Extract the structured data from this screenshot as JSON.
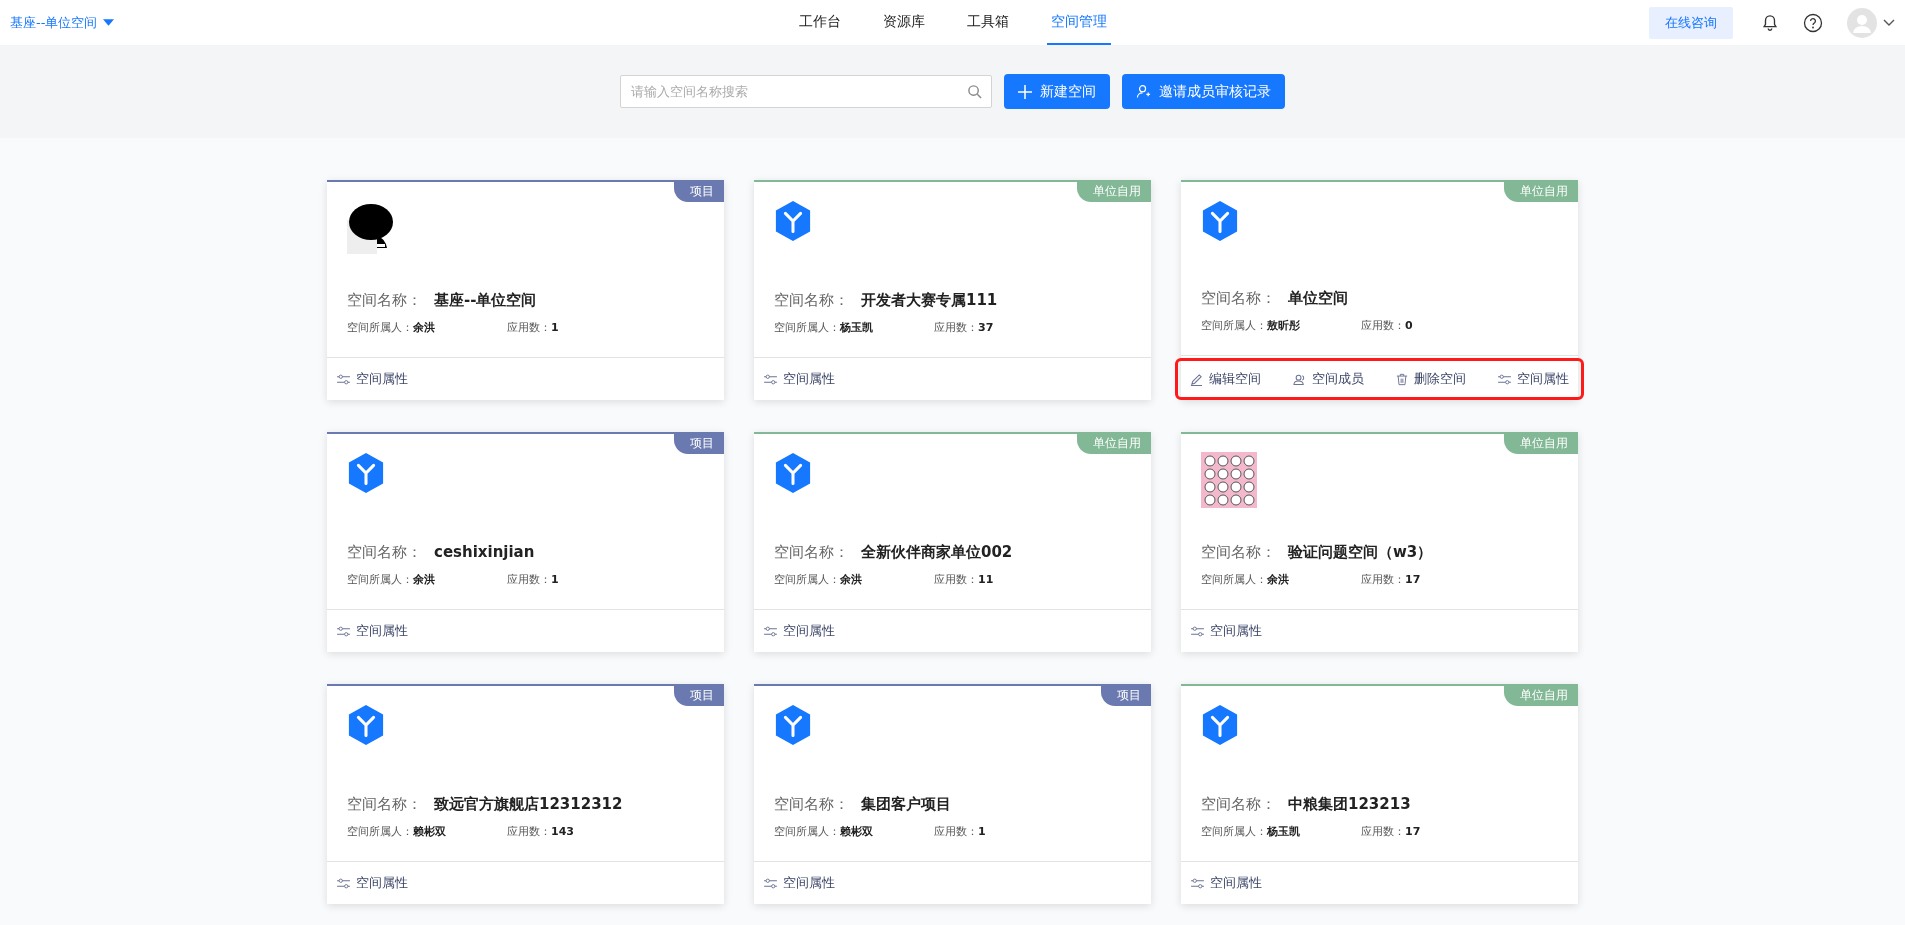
{
  "header": {
    "workspace": "基座--单位空间",
    "tabs": [
      {
        "label": "工作台",
        "selected": false
      },
      {
        "label": "资源库",
        "selected": false
      },
      {
        "label": "工具箱",
        "selected": false
      },
      {
        "label": "空间管理",
        "selected": true
      }
    ],
    "consult_button": "在线咨询"
  },
  "toolbar": {
    "search": {
      "placeholder": "请输入空间名称搜索"
    },
    "buttons": [
      {
        "kind": "plus",
        "label": "新建空间"
      },
      {
        "kind": "person",
        "label": "邀请成员审核记录"
      }
    ]
  },
  "cards": [
    {
      "tag": "项目",
      "color": "#6a7ab0",
      "kind": "achs",
      "name_label": "空间名称：",
      "name": "基座--单位空间",
      "owner_label": "空间所属人：",
      "owner": "余洪",
      "apps_label": "应用数：",
      "apps": "1",
      "highlighted": false,
      "actions": [
        {
          "kind": "props",
          "label": "空间属性"
        }
      ]
    },
    {
      "tag": "单位自用",
      "color": "#82b895",
      "kind": "cube",
      "name_label": "空间名称：",
      "name": "开发者大赛专属111",
      "owner_label": "空间所属人：",
      "owner": "杨玉凯",
      "apps_label": "应用数：",
      "apps": "37",
      "highlighted": false,
      "actions": [
        {
          "kind": "props",
          "label": "空间属性"
        }
      ]
    },
    {
      "tag": "单位自用",
      "color": "#82b895",
      "kind": "cube",
      "name_label": "空间名称：",
      "name": "单位空间",
      "owner_label": "空间所属人：",
      "owner": "敖昕彤",
      "apps_label": "应用数：",
      "apps": "0",
      "highlighted": true,
      "actions": [
        {
          "kind": "edit",
          "label": "编辑空间"
        },
        {
          "kind": "members",
          "label": "空间成员"
        },
        {
          "kind": "delete",
          "label": "删除空间"
        },
        {
          "kind": "props",
          "label": "空间属性"
        }
      ]
    },
    {
      "tag": "项目",
      "color": "#6a7ab0",
      "kind": "cube",
      "name_label": "空间名称：",
      "name": "ceshixinjian",
      "owner_label": "空间所属人：",
      "owner": "余洪",
      "apps_label": "应用数：",
      "apps": "1",
      "highlighted": false,
      "actions": [
        {
          "kind": "props",
          "label": "空间属性"
        }
      ]
    },
    {
      "tag": "单位自用",
      "color": "#82b895",
      "kind": "cube",
      "name_label": "空间名称：",
      "name": "全新伙伴商家单位002",
      "owner_label": "空间所属人：",
      "owner": "余洪",
      "apps_label": "应用数：",
      "apps": "11",
      "highlighted": false,
      "actions": [
        {
          "kind": "props",
          "label": "空间属性"
        }
      ]
    },
    {
      "tag": "单位自用",
      "color": "#82b895",
      "kind": "pattern",
      "name_label": "空间名称：",
      "name": "验证问题空间（w3）",
      "owner_label": "空间所属人：",
      "owner": "余洪",
      "apps_label": "应用数：",
      "apps": "17",
      "highlighted": false,
      "actions": [
        {
          "kind": "props",
          "label": "空间属性"
        }
      ]
    },
    {
      "tag": "项目",
      "color": "#6a7ab0",
      "kind": "cube",
      "name_label": "空间名称：",
      "name": "致远官方旗舰店12312312",
      "owner_label": "空间所属人：",
      "owner": "赖彬双",
      "apps_label": "应用数：",
      "apps": "143",
      "highlighted": false,
      "actions": [
        {
          "kind": "props",
          "label": "空间属性"
        }
      ]
    },
    {
      "tag": "项目",
      "color": "#6a7ab0",
      "kind": "cube",
      "name_label": "空间名称：",
      "name": "集团客户项目",
      "owner_label": "空间所属人：",
      "owner": "赖彬双",
      "apps_label": "应用数：",
      "apps": "1",
      "highlighted": false,
      "actions": [
        {
          "kind": "props",
          "label": "空间属性"
        }
      ]
    },
    {
      "tag": "单位自用",
      "color": "#82b895",
      "kind": "cube",
      "name_label": "空间名称：",
      "name": "中粮集团123213",
      "owner_label": "空间所属人：",
      "owner": "杨玉凯",
      "apps_label": "应用数：",
      "apps": "17",
      "highlighted": false,
      "actions": [
        {
          "kind": "props",
          "label": "空间属性"
        }
      ]
    }
  ]
}
